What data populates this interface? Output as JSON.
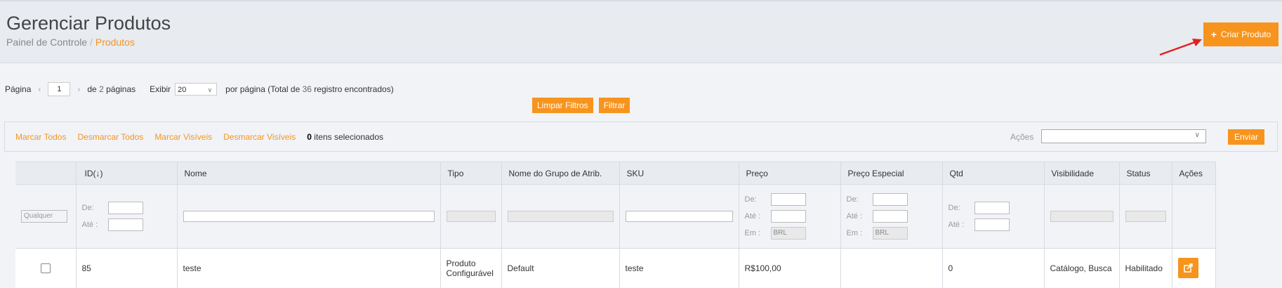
{
  "header": {
    "title": "Gerenciar Produtos",
    "breadcrumb": {
      "home": "Painel de Controle",
      "separator": "/",
      "current": "Produtos"
    },
    "create_label": "Criar Produto"
  },
  "pager": {
    "page_label": "Página",
    "page_value": "1",
    "of_text": "de",
    "total_pages": "2",
    "pages_text": "páginas",
    "show_label": "Exibir",
    "per_page_value": "20",
    "per_page_text": "por página (Total de",
    "total_records": "36",
    "records_text": "registro encontrados)"
  },
  "filters": {
    "clear_label": "Limpar Filtros",
    "filter_label": "Filtrar"
  },
  "massaction": {
    "select_all": "Marcar Todos",
    "unselect_all": "Desmarcar Todos",
    "select_visible": "Marcar Visíveis",
    "unselect_visible": "Desmarcar Visíveis",
    "selected_count": "0",
    "selected_text": "itens selecionados",
    "actions_label": "Ações",
    "submit_label": "Enviar"
  },
  "grid": {
    "columns": [
      "",
      "ID(↓)",
      "Nome",
      "Tipo",
      "Nome do Grupo de Atrib.",
      "SKU",
      "Preço",
      "Preço Especial",
      "Qtd",
      "Visibilidade",
      "Status",
      "Ações"
    ],
    "filter": {
      "any": "Qualquer",
      "from": "De:",
      "to": "Até :",
      "in": "Em :",
      "currency": "BRL"
    },
    "rows": [
      {
        "id": "85",
        "name": "teste",
        "type": "Produto Configurável",
        "attr_set": "Default",
        "sku": "teste",
        "price": "R$100,00",
        "special_price": "",
        "qty": "0",
        "visibility": "Catálogo, Busca",
        "status": "Habilitado"
      }
    ]
  },
  "colors": {
    "accent": "#f7941d",
    "arrow": "#e02020",
    "header_bg": "#e8ebf0"
  }
}
